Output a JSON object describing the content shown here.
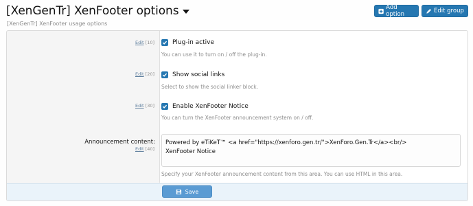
{
  "header": {
    "title": "[XenGenTr] XenFooter options",
    "description": "[XenGenTr] XenFooter usage options",
    "add_option_label": "Add option",
    "edit_group_label": "Edit group"
  },
  "options": [
    {
      "edit_label": "Edit",
      "order": "[10]",
      "checkbox_label": "Plug-in active",
      "checked": true,
      "hint": "You can use it to turn on / off the plug-in."
    },
    {
      "edit_label": "Edit",
      "order": "[20]",
      "checkbox_label": "Show social links",
      "checked": true,
      "hint": "Select to show the social linker block."
    },
    {
      "edit_label": "Edit",
      "order": "[30]",
      "checkbox_label": "Enable XenFooter Notice",
      "checked": true,
      "hint": "You can turn the XenFooter announcement system on / off."
    }
  ],
  "announcement": {
    "label": "Announcement content:",
    "edit_label": "Edit",
    "order": "[40]",
    "value": "Powered by eTiKeT™ <a href=\"https://xenforo.gen.tr/\">XenForo.Gen.Tr</a><br/>\nXenFooter Notice",
    "hint": "Specify your XenFooter announcement content from this area. You can use HTML in this area."
  },
  "footer": {
    "save_label": "Save"
  },
  "colors": {
    "accent": "#2577b1",
    "save_button": "#5a9bd3",
    "footer_bg": "#eaf3fa"
  },
  "icons": {
    "add_option": "plus-square-icon",
    "edit_group": "pencil-icon",
    "save": "floppy-disk-icon",
    "title_menu": "caret-down-icon",
    "checkbox": "checkmark-icon"
  }
}
